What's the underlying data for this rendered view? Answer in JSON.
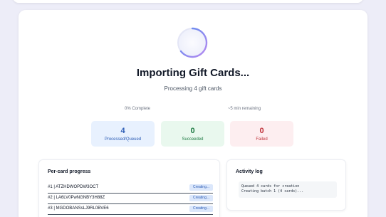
{
  "header": {
    "title": "Importing Gift Cards...",
    "subtitle": "Processing 4 gift cards"
  },
  "progress": {
    "percent_label": "0% Complete",
    "percent_value": 0,
    "remaining_label": "~5 min remaining"
  },
  "stats": {
    "processed": {
      "value": "4",
      "label": "Processed/Queued"
    },
    "succeeded": {
      "value": "0",
      "label": "Succeeded"
    },
    "failed": {
      "value": "0",
      "label": "Failed"
    }
  },
  "per_card": {
    "title": "Per-card progress",
    "rows": [
      {
        "id": "#1 | ATZHDWOPDW3OCT",
        "status": "Creating..."
      },
      {
        "id": "#2 | LA6LV0PwNGNBY3H88Z",
        "status": "Creating..."
      },
      {
        "id": "#3 | MGDOBANSsLJ9RL0BVE6",
        "status": "Creating..."
      }
    ]
  },
  "activity_log": {
    "title": "Activity log",
    "lines": [
      "Queued 4 cards for creation",
      "Creating batch 1 (4 cards)..."
    ]
  },
  "colors": {
    "accent_blue": "#2c5cb5",
    "success_green": "#1e7a43",
    "danger_red": "#c0343c",
    "spinner_gradient": [
      "#5b8def",
      "#b88af0"
    ]
  },
  "icons": {
    "spinner": "loading-spinner-icon"
  }
}
